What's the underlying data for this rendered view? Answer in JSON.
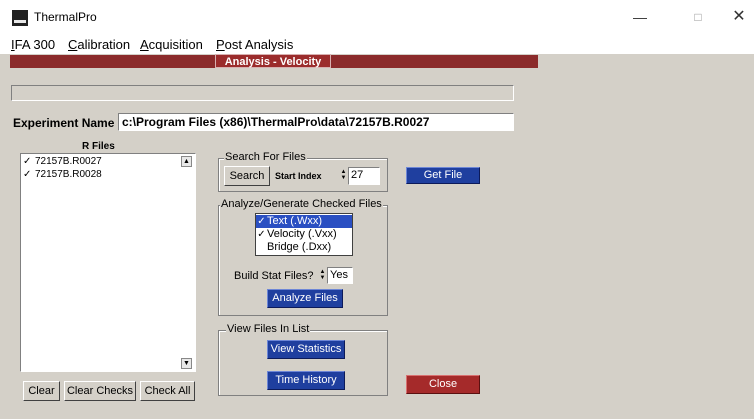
{
  "window": {
    "title": "ThermalPro",
    "minimize": "—",
    "maximize": "□",
    "close": "✕"
  },
  "menu": {
    "items": [
      {
        "accel": "I",
        "rest": "FA 300"
      },
      {
        "accel": "C",
        "rest": "alibration"
      },
      {
        "accel": "A",
        "rest": "cquisition"
      },
      {
        "accel": "P",
        "rest": "ost Analysis"
      }
    ]
  },
  "banner": {
    "title": "Analysis - Velocity"
  },
  "experiment": {
    "label": "Experiment Name",
    "value": "c:\\Program Files (x86)\\ThermalPro\\data\\72157B.R0027"
  },
  "rfiles": {
    "label": "R Files",
    "items": [
      {
        "name": "72157B.R0027",
        "checked": "✓"
      },
      {
        "name": "72157B.R0028",
        "checked": "✓"
      }
    ],
    "scroll_up": "▲",
    "scroll_down": "▼",
    "clear_label": "Clear",
    "clear_checks_label": "Clear Checks",
    "check_all_label": "Check All"
  },
  "search": {
    "group_title": "Search For Files",
    "search_label": "Search",
    "start_index_label": "Start Index",
    "start_index_value": "27",
    "get_file_label": "Get File"
  },
  "analyze": {
    "group_title": "Analyze/Generate Checked Files",
    "types": [
      {
        "name": "Text",
        "ext": "(.Wxx)",
        "checked": "✓"
      },
      {
        "name": "Velocity",
        "ext": "(.Vxx)",
        "checked": "✓"
      },
      {
        "name": "Bridge",
        "ext": "(.Dxx)",
        "checked": ""
      }
    ],
    "build_stat_label": "Build Stat Files?",
    "build_stat_value": "Yes",
    "analyze_label": "Analyze Files"
  },
  "view": {
    "group_title": "View Files In List",
    "statistics_label": "View Statistics",
    "time_history_label": "Time History"
  },
  "close_label": "Close"
}
